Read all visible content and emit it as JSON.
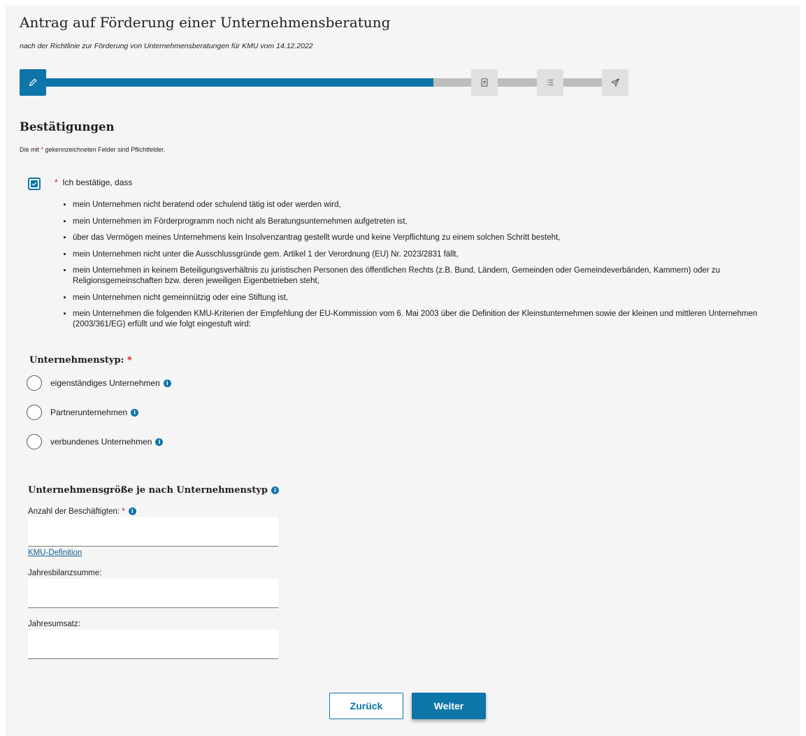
{
  "header": {
    "title": "Antrag auf Förderung einer Unternehmensberatung",
    "subtitle": "nach der Richtlinie zur Förderung von Unternehmensberatungen für KMU vom 14.12.2022"
  },
  "stepper": {
    "progress_percent": 64,
    "steps": [
      {
        "icon": "pencil-icon",
        "active": true
      },
      {
        "icon": "upload-document-icon",
        "active": false
      },
      {
        "icon": "list-icon",
        "active": false
      },
      {
        "icon": "send-icon",
        "active": false
      }
    ],
    "colors": {
      "active": "#0e75a8",
      "inactive": "#bdbdbd"
    }
  },
  "section": {
    "title": "Bestätigungen",
    "required_hint_prefix": "Die mit ",
    "required_star": "*",
    "required_hint_suffix": " gekennzeichneten Felder sind Pflichtfelder."
  },
  "confirmation": {
    "checked": true,
    "star": "*",
    "label": "Ich bestätige, dass",
    "items": [
      "mein Unternehmen nicht beratend oder schulend tätig ist oder werden wird,",
      "mein Unternehmen im Förderprogramm noch nicht als Beratungsunternehmen aufgetreten ist,",
      "über das Vermögen meines Unternehmens kein Insolvenzantrag gestellt wurde und keine Verpflichtung zu einem solchen Schritt besteht,",
      "mein Unternehmen nicht unter die Ausschlussgründe gem. Artikel 1 der Verordnung (EU) Nr. 2023/2831 fällt,",
      "mein Unternehmen in keinem Beteiligungsverhältnis zu juristischen Personen des öffentlichen Rechts (z.B. Bund, Ländern, Gemeinden oder Gemeindeverbänden, Kammern) oder zu Religionsgemeinschaften bzw. deren jeweiligen Eigenbetrieben steht,",
      "mein Unternehmen nicht gemeinnützig oder eine Stiftung ist,",
      "mein Unternehmen die folgenden KMU-Kriterien der Empfehlung der EU-Kommission vom 6. Mai 2003 über die Definition der Kleinstunternehmen sowie der kleinen und mittleren Unternehmen (2003/361/EG) erfüllt und wie folgt eingestuft wird:"
    ]
  },
  "company_type": {
    "label": "Unternehmenstyp:",
    "star": "*",
    "options": [
      "eigenständiges Unternehmen",
      "Partnerunternehmen",
      "verbundenes Unternehmen"
    ],
    "info_glyph": "i"
  },
  "company_size": {
    "title": "Unternehmensgröße je nach Unternehmenstyp",
    "employees_label": "Anzahl der Beschäftigten:",
    "employees_star": "*",
    "employees_value": "",
    "kmu_link": "KMU-Definition",
    "balance_label": "Jahresbilanzsumme:",
    "balance_value": "",
    "revenue_label": "Jahresumsatz:",
    "revenue_value": ""
  },
  "buttons": {
    "back": "Zurück",
    "next": "Weiter"
  }
}
